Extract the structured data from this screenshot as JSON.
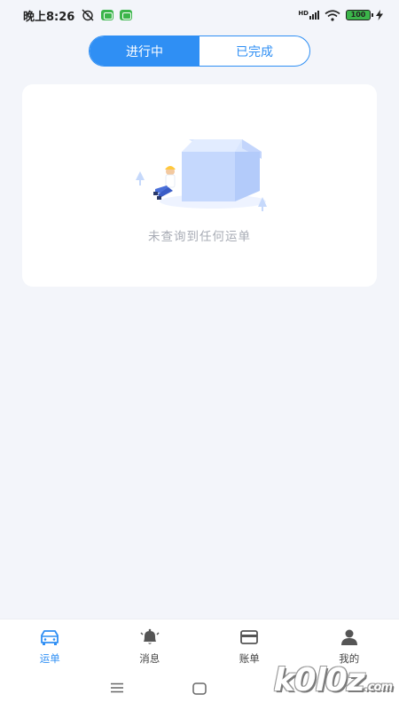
{
  "status_bar": {
    "time": "晚上8:26",
    "network": "HD",
    "battery": "100"
  },
  "tabs": [
    {
      "label": "进行中",
      "active": true
    },
    {
      "label": "已完成",
      "active": false
    }
  ],
  "empty_state": {
    "message": "未查询到任何运单"
  },
  "bottom_nav": [
    {
      "label": "运单",
      "icon": "truck-icon",
      "active": true
    },
    {
      "label": "消息",
      "icon": "bell-icon",
      "active": false
    },
    {
      "label": "账单",
      "icon": "card-icon",
      "active": false
    },
    {
      "label": "我的",
      "icon": "user-icon",
      "active": false
    }
  ],
  "watermark": {
    "text": "k0l0z",
    "suffix": ".com"
  },
  "colors": {
    "accent": "#2f8ff4",
    "background": "#f3f5fa",
    "muted_text": "#a8acb5"
  }
}
